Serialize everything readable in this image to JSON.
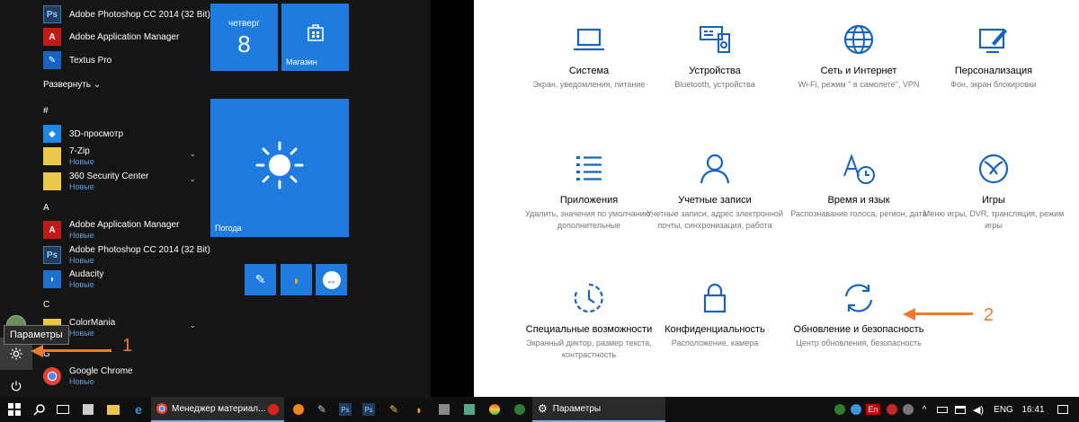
{
  "start_menu": {
    "tooltip": "Параметры",
    "expand_label": "Развернуть",
    "apps": [
      {
        "name": "Adobe Photoshop CC 2014 (32 Bit)",
        "icon": "ps-icon"
      },
      {
        "name": "Adobe Application Manager",
        "icon": "adobe-icon"
      },
      {
        "name": "Textus Pro",
        "icon": "textus-icon"
      },
      {
        "name": "3D-просмотр",
        "icon": "3d-viewer-icon"
      },
      {
        "name": "7-Zip",
        "badge": "Новые",
        "icon": "folder-icon"
      },
      {
        "name": "360 Security Center",
        "badge": "Новые",
        "icon": "folder-icon"
      },
      {
        "name": "Adobe Application Manager",
        "badge": "Новые",
        "icon": "adobe-icon"
      },
      {
        "name": "Adobe Photoshop CC 2014 (32 Bit)",
        "badge": "Новые",
        "icon": "ps-icon"
      },
      {
        "name": "Audacity",
        "badge": "Новые",
        "icon": "audacity-icon"
      },
      {
        "name": "ColorMania",
        "badge": "Новые",
        "icon": "folder-icon"
      },
      {
        "name": "Google Chrome",
        "badge": "Новые",
        "icon": "chrome-icon"
      }
    ],
    "letters": [
      "#",
      "A",
      "C",
      "G"
    ],
    "tiles": {
      "calendar_day": "четверг",
      "calendar_num": "8",
      "store_label": "Магазин",
      "weather_label": "Погода"
    }
  },
  "settings": {
    "categories": [
      {
        "title": "Система",
        "desc": "Экран, уведомления, питание",
        "icon": "laptop-icon"
      },
      {
        "title": "Устройства",
        "desc": "Bluetooth, устройства",
        "icon": "devices-icon"
      },
      {
        "title": "Сеть и Интернет",
        "desc": "Wi-Fi, режим \" в самолете\", VPN",
        "icon": "globe-icon"
      },
      {
        "title": "Персонализация",
        "desc": "Фон, экран блокировки",
        "icon": "personalization-icon"
      },
      {
        "title": "Приложения",
        "desc": "Удалить, значения по умолчанию, дополнительные",
        "icon": "apps-list-icon"
      },
      {
        "title": "Учетные записи",
        "desc": "Учетные записи, адрес электронной почты, синхронизация, работа",
        "icon": "person-icon"
      },
      {
        "title": "Время и язык",
        "desc": "Распознавание голоса, регион, дата",
        "icon": "time-language-icon"
      },
      {
        "title": "Игры",
        "desc": "Меню игры, DVR, трансляция, режим игры",
        "icon": "xbox-icon"
      },
      {
        "title": "Специальные возможности",
        "desc": "Экранный диктор, размер текста, контрастность",
        "icon": "ease-of-access-icon"
      },
      {
        "title": "Конфиденциальность",
        "desc": "Расположение, камера",
        "icon": "lock-icon"
      },
      {
        "title": "Обновление и безопасность",
        "desc": "Центр обновления, безопасность",
        "icon": "update-icon"
      }
    ]
  },
  "annotations": {
    "arrow1": "1",
    "arrow2": "2"
  },
  "taskbar": {
    "window1": "Менеджер материал...",
    "window2": "Параметры",
    "language": "ENG",
    "time": "16:41"
  },
  "colors": {
    "accent": "#1e7be0",
    "annotation": "#f07b2b",
    "settings_icon": "#1565c0"
  }
}
